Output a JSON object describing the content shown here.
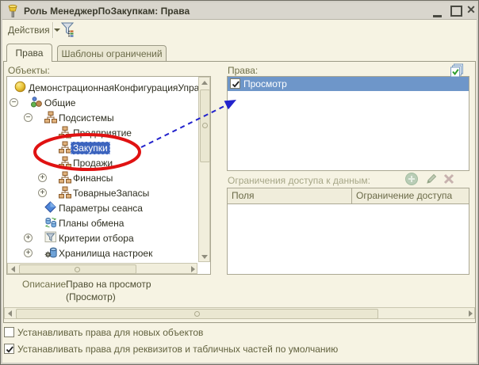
{
  "window": {
    "title": "Роль МенеджерПоЗакупкам: Права",
    "controls": [
      "minimize",
      "maximize",
      "close"
    ]
  },
  "toolbar": {
    "actions_label": "Действия",
    "filter_icon": "filter-icon"
  },
  "tabs": [
    {
      "label": "Права",
      "active": true
    },
    {
      "label": "Шаблоны ограничений",
      "active": false
    }
  ],
  "objects": {
    "label": "Объекты:",
    "tree": [
      {
        "label": "ДемонстрационнаяКонфигурацияУправл",
        "level": 0,
        "icon": "configuration-icon",
        "expander": null,
        "selected": false
      },
      {
        "label": "Общие",
        "level": 1,
        "icon": "common-icon",
        "expander": "minus",
        "selected": false
      },
      {
        "label": "Подсистемы",
        "level": 2,
        "icon": "subsystem-icon",
        "expander": "minus",
        "selected": false
      },
      {
        "label": "Предприятие",
        "level": 3,
        "icon": "subsystem-icon",
        "expander": null,
        "selected": false
      },
      {
        "label": "Закупки",
        "level": 3,
        "icon": "subsystem-icon",
        "expander": null,
        "selected": true
      },
      {
        "label": "Продажи",
        "level": 3,
        "icon": "subsystem-icon",
        "expander": null,
        "selected": false
      },
      {
        "label": "Финансы",
        "level": 3,
        "icon": "subsystem-icon",
        "expander": "plus",
        "selected": false
      },
      {
        "label": "ТоварныеЗапасы",
        "level": 3,
        "icon": "subsystem-icon",
        "expander": "plus",
        "selected": false
      },
      {
        "label": "Параметры сеанса",
        "level": 2,
        "icon": "session-parameter-icon",
        "expander": null,
        "selected": false
      },
      {
        "label": "Планы обмена",
        "level": 2,
        "icon": "exchange-plan-icon",
        "expander": null,
        "selected": false
      },
      {
        "label": "Критерии отбора",
        "level": 2,
        "icon": "filter-criteria-icon",
        "expander": "plus",
        "selected": false
      },
      {
        "label": "Хранилища настроек",
        "level": 2,
        "icon": "settings-storage-icon",
        "expander": "plus",
        "selected": false
      }
    ]
  },
  "rights": {
    "label": "Права:",
    "items": [
      {
        "label": "Просмотр",
        "checked": true,
        "selected": true
      }
    ]
  },
  "restrictions": {
    "label": "Ограничения доступа к данным:",
    "columns": [
      "Поля",
      "Ограничение доступа"
    ],
    "rows": [],
    "toolbar": [
      "add",
      "edit",
      "delete"
    ]
  },
  "description": {
    "label": "Описание:",
    "lines": [
      "Право на просмотр",
      "(Просмотр)"
    ]
  },
  "footer_checkboxes": [
    {
      "label": "Устанавливать права для новых объектов",
      "checked": false
    },
    {
      "label": "Устанавливать права для реквизитов и табличных частей по умолчанию",
      "checked": true
    }
  ],
  "colors": {
    "background": "#F6F3E3",
    "titlebar": "#D9D6CD",
    "tree_selection_blue": "#3C64BE",
    "list_selection_blue": "#6E96C9",
    "annotation_red": "#E01212",
    "annotation_arrow_blue": "#2323CC"
  },
  "annotations": {
    "ellipse_target": "Закупки",
    "arrow_target": "Просмотр"
  }
}
